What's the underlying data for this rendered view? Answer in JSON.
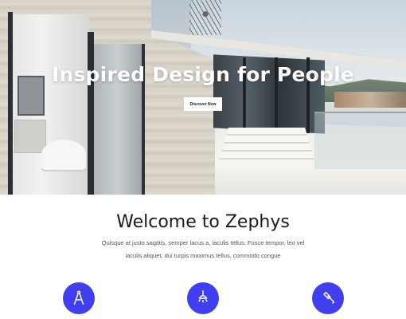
{
  "hero": {
    "title": "Inspired Design for People",
    "button_label": "Discover Now"
  },
  "welcome": {
    "title": "Welcome to Zephys",
    "line1": "Quisque at justo sagittis, semper lacus a, iaculis tellus. Fusce tempor, leo vel",
    "line2": "iaculis aliquet, dui turpis maximus tellus, commodo congue"
  },
  "features": [
    {
      "icon": "compass-icon"
    },
    {
      "icon": "ceiling-lamp-icon"
    },
    {
      "icon": "hammer-icon"
    }
  ],
  "colors": {
    "accent": "#3f3ff0",
    "heading": "#1a1a1a",
    "body_text": "#555555"
  }
}
